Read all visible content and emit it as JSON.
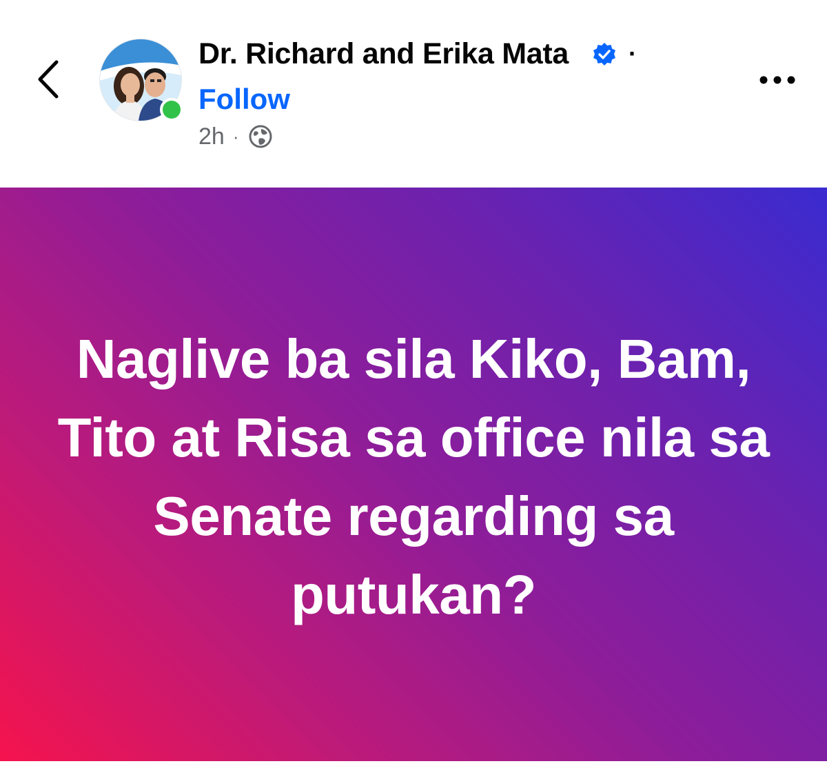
{
  "header": {
    "author_name": "Dr. Richard and Erika Mata",
    "name_separator": "·",
    "follow_label": "Follow",
    "timestamp": "2h",
    "meta_separator": "·",
    "audience_icon": "globe-icon",
    "back_icon": "chevron-left-icon",
    "more_icon": "more-horizontal-icon",
    "verified_icon": "verified-badge-icon",
    "online_status": "online"
  },
  "post": {
    "text": "Naglive ba sila Kiko, Bam, Tito at Risa sa office nila sa Senate regarding sa putukan?",
    "background_gradient": [
      "#3a2bd0",
      "#8d1d9a",
      "#f5134d"
    ],
    "text_color": "#ffffff"
  },
  "colors": {
    "accent": "#0866ff",
    "online": "#31c24a",
    "muted_text": "#65676b",
    "primary_text": "#050505"
  }
}
